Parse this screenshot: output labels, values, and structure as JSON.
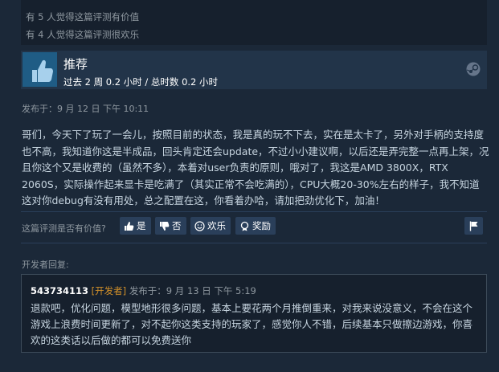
{
  "helpful": {
    "line1": "有 5 人觉得这篇评测有价值",
    "line2": "有 4 人觉得这篇评测很欢乐"
  },
  "review": {
    "verdict": "推荐",
    "hours": "过去 2 周 0.2 小时 / 总时数 0.2 小时",
    "posted": "发布于：9 月 12 日 下午 10:11",
    "body": "哥们，今天下了玩了一会儿，按照目前的状态，我是真的玩不下去，实在是太卡了，另外对手柄的支持度也不高，我知道你这是半成品，回头肯定还会update，不过小小建议啊，以后还是弄完整一点再上架，况且你这个又是收费的（虽然不多），本着对user负责的原则，哦对了，我这是AMD 3800X，RTX 2060S，实际操作起来显卡是吃满了（其实正常不会吃满的），CPU大概20-30%左右的样子，我不知道这对你debug有没有用处，总之配置在这，你看着办哈，请加把劲优化下，加油！"
  },
  "voting": {
    "prompt": "这篇评测是否有价值?",
    "yes": "是",
    "no": "否",
    "funny": "欢乐",
    "award": "奖励"
  },
  "developer": {
    "label": "开发者回复:",
    "name": "543734113",
    "tag": "[开发者]",
    "date": "发布于：9 月 13 日 下午 5:19",
    "text": "退款吧，优化问题，模型地形很多问题，基本上要花两个月推倒重来，对我来说没意义，不会在这个游戏上浪费时间更新了，对不起你这类支持的玩家了，感觉你人不错，后续基本只做擦边游戏，你喜欢的这类话以后做的都可以免费送你"
  },
  "icons": {
    "thumb": "thumbs-up-icon",
    "steam": "steam-icon",
    "flag": "flag-icon"
  },
  "colors": {
    "background": "#1b2838",
    "panel": "#16202d",
    "header": "#223449",
    "button": "#2a3f5a",
    "dev_tag": "#d08f2a"
  }
}
